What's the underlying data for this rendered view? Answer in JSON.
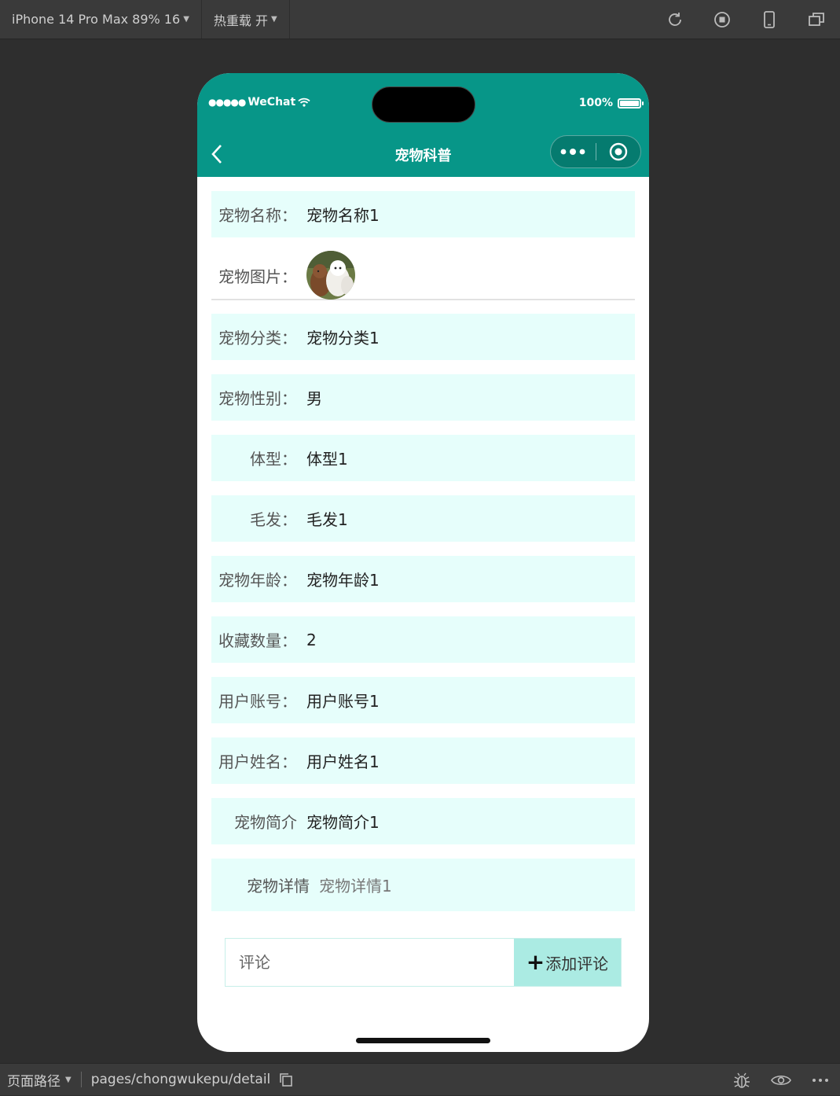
{
  "toolbar": {
    "device": "iPhone 14 Pro Max 89% 16",
    "hot_reload": "热重载 开"
  },
  "statusbar": {
    "carrier": "WeChat",
    "battery": "100%"
  },
  "navbar": {
    "title": "宠物科普"
  },
  "fields": [
    {
      "label": "宠物名称：",
      "value": "宠物名称1"
    },
    {
      "label": "宠物图片：",
      "value": ""
    },
    {
      "label": "宠物分类：",
      "value": "宠物分类1"
    },
    {
      "label": "宠物性别：",
      "value": "男"
    },
    {
      "label": "体型：",
      "value": "体型1"
    },
    {
      "label": "毛发：",
      "value": "毛发1"
    },
    {
      "label": "宠物年龄：",
      "value": "宠物年龄1"
    },
    {
      "label": "收藏数量：",
      "value": "2"
    },
    {
      "label": "用户账号：",
      "value": "用户账号1"
    },
    {
      "label": "用户姓名：",
      "value": "用户姓名1"
    },
    {
      "label": "宠物简介",
      "value": "宠物简介1"
    },
    {
      "label": "宠物详情",
      "value": "宠物详情1"
    }
  ],
  "comment": {
    "placeholder": "评论",
    "button_label": "添加评论"
  },
  "bottombar": {
    "path_label": "页面路径",
    "path": "pages/chongwukepu/detail"
  },
  "colors": {
    "header": "#079688",
    "row_bg": "#e6fefb",
    "button_bg": "#abebe3"
  }
}
